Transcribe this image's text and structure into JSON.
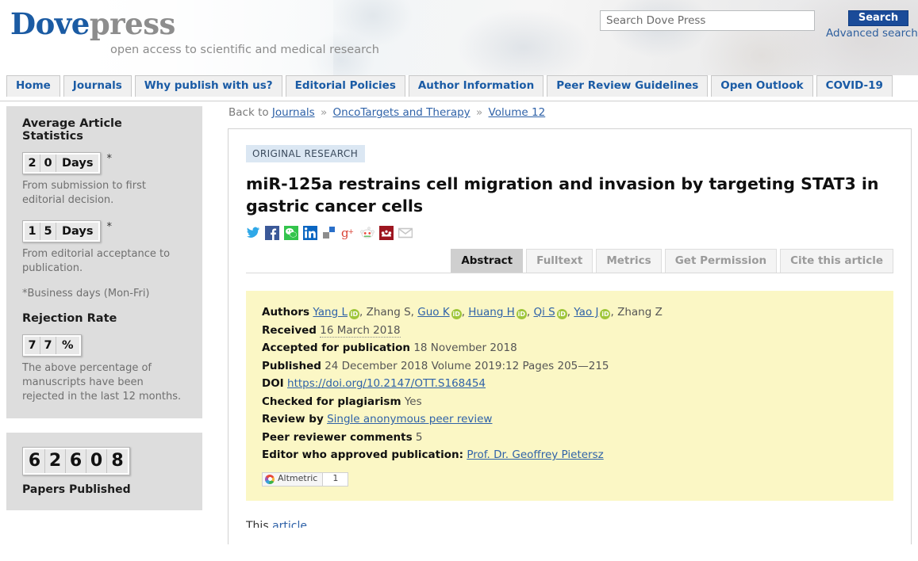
{
  "header": {
    "logo_primary": "Dove",
    "logo_secondary": "press",
    "tagline": "open access to scientific and medical research",
    "search_placeholder": "Search Dove Press",
    "search_value": "",
    "search_button": "Search",
    "advanced_search": "Advanced search"
  },
  "nav": {
    "items": [
      {
        "label": "Home"
      },
      {
        "label": "Journals"
      },
      {
        "label": "Why publish with us?"
      },
      {
        "label": "Editorial Policies"
      },
      {
        "label": "Author Information"
      },
      {
        "label": "Peer Review Guidelines"
      },
      {
        "label": "Open Outlook"
      },
      {
        "label": "COVID-19"
      }
    ]
  },
  "sidebar": {
    "stats_title": "Average Article Statistics",
    "stat1": {
      "digits": [
        "2",
        "0"
      ],
      "unit": "Days",
      "asterisk": "*",
      "note": "From submission to first editorial decision."
    },
    "stat2": {
      "digits": [
        "1",
        "5"
      ],
      "unit": "Days",
      "asterisk": "*",
      "note": "From editorial acceptance to publication."
    },
    "business_days_note": "*Business days (Mon-Fri)",
    "rejection_title": "Rejection Rate",
    "rejection": {
      "digits": [
        "7",
        "7"
      ],
      "unit": "%",
      "note": "The above percentage of manuscripts have been rejected in the last 12 months."
    },
    "papers": {
      "digits": [
        "6",
        "2",
        "6",
        "0",
        "8"
      ],
      "label": "Papers Published"
    }
  },
  "breadcrumb": {
    "prefix": "Back to",
    "journals": "Journals",
    "journal_name": "OncoTargets and Therapy",
    "volume": "Volume 12",
    "separator": "»"
  },
  "article": {
    "type_badge": "ORIGINAL RESEARCH",
    "title": "miR-125a restrains cell migration and invasion by targeting STAT3 in gastric cancer cells",
    "social_icons": [
      {
        "name": "twitter-icon",
        "glyph": "🐦",
        "color": "#2fa8e8"
      },
      {
        "name": "facebook-icon",
        "glyph": "f",
        "color": "#3b5998"
      },
      {
        "name": "wechat-icon",
        "glyph": "✉",
        "color": "#33c44c"
      },
      {
        "name": "linkedin-icon",
        "glyph": "in",
        "color": "#0a66c2"
      },
      {
        "name": "delicious-icon",
        "glyph": "",
        "color": "#8a8a8a"
      },
      {
        "name": "googleplus-icon",
        "glyph": "g+",
        "color": "#d94235"
      },
      {
        "name": "reddit-icon",
        "glyph": "",
        "color": "#ff4500"
      },
      {
        "name": "mendeley-icon",
        "glyph": "m",
        "color": "#9d1620"
      },
      {
        "name": "email-icon",
        "glyph": "✉",
        "color": "#c6c6c6"
      }
    ],
    "tabs": [
      {
        "label": "Abstract",
        "active": true
      },
      {
        "label": "Fulltext",
        "active": false
      },
      {
        "label": "Metrics",
        "active": false
      },
      {
        "label": "Get Permission",
        "active": false
      },
      {
        "label": "Cite this article",
        "active": false
      }
    ],
    "meta": {
      "authors_label": "Authors",
      "authors": [
        {
          "name": "Yang L",
          "link": true,
          "orcid": true
        },
        {
          "name": "Zhang S",
          "link": false,
          "orcid": false
        },
        {
          "name": "Guo K",
          "link": true,
          "orcid": true
        },
        {
          "name": "Huang H",
          "link": true,
          "orcid": true
        },
        {
          "name": "Qi S",
          "link": true,
          "orcid": true
        },
        {
          "name": "Yao J",
          "link": true,
          "orcid": true
        },
        {
          "name": "Zhang Z",
          "link": false,
          "orcid": false
        }
      ],
      "received_label": "Received",
      "received_value": "16 March 2018",
      "accepted_label": "Accepted for publication",
      "accepted_value": "18 November 2018",
      "published_label": "Published",
      "published_value": "24 December 2018 Volume 2019:12 Pages 205—215",
      "doi_label": "DOI",
      "doi_value": "https://doi.org/10.2147/OTT.S168454",
      "plagiarism_label": "Checked for plagiarism",
      "plagiarism_value": "Yes",
      "review_label": "Review by",
      "review_value": "Single anonymous peer review",
      "comments_label": "Peer reviewer comments",
      "comments_value": "5",
      "editor_label": "Editor who approved publication:",
      "editor_value": "Prof. Dr. Geoffrey Pietersz",
      "altmetric_label": "Altmetric",
      "altmetric_count": "1",
      "orcid_glyph": "iD"
    },
    "below_text_prefix": "This ",
    "below_text_link": "article"
  }
}
